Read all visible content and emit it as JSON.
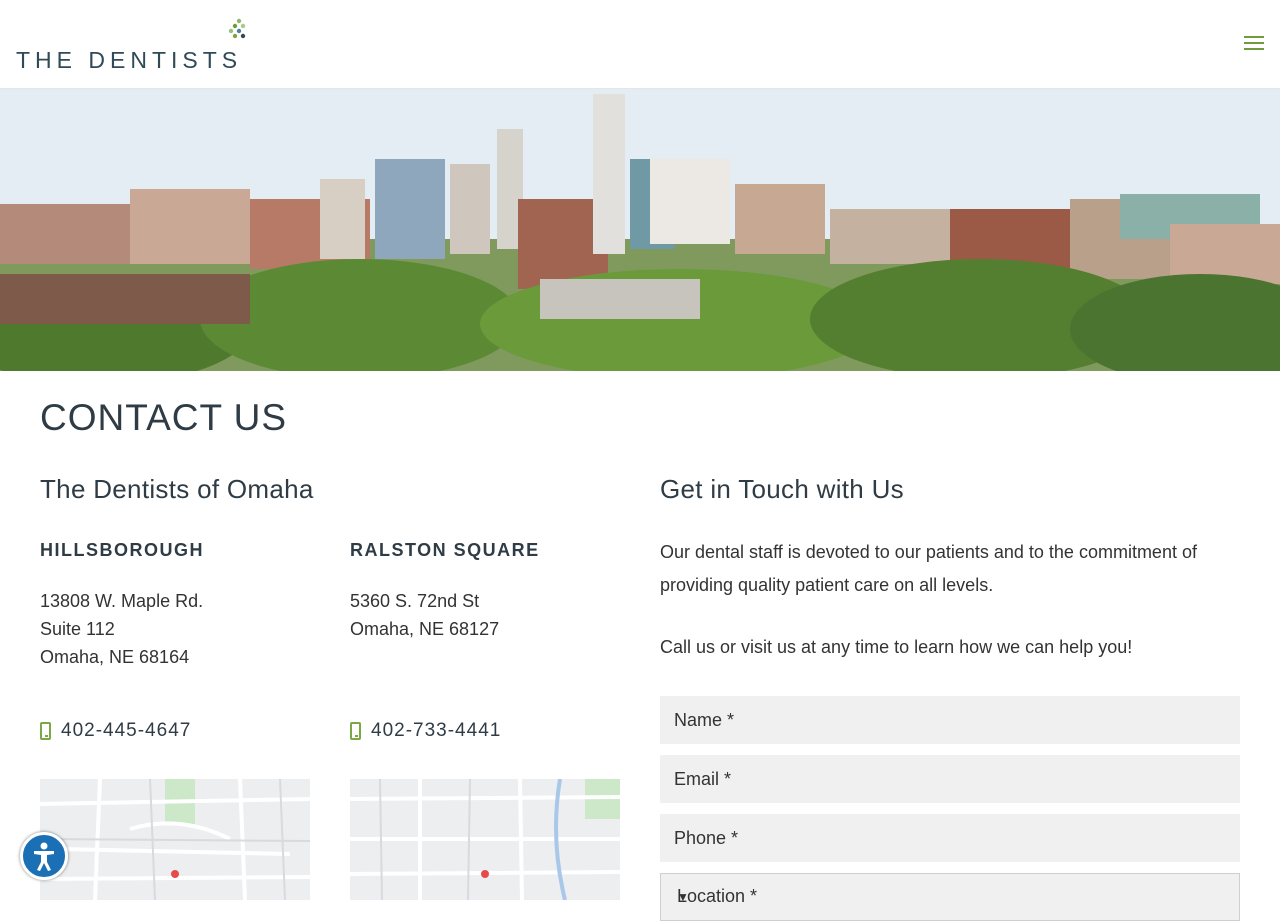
{
  "header": {
    "logo_text": "THE DENTISTS",
    "menu_icon": "hamburger-icon",
    "accent_color": "#7ba744"
  },
  "page": {
    "title": "CONTACT US"
  },
  "locations": {
    "heading": "The Dentists of Omaha",
    "items": [
      {
        "name": "HILLSBOROUGH",
        "address_lines": [
          "13808 W. Maple Rd.",
          "Suite 112",
          "Omaha, NE 68164"
        ],
        "phone": "402-445-4647",
        "phone_icon": "mobile-phone-icon"
      },
      {
        "name": "RALSTON SQUARE",
        "address_lines": [
          "5360 S. 72nd St",
          "Omaha, NE 68127"
        ],
        "phone": "402-733-4441",
        "phone_icon": "mobile-phone-icon"
      }
    ]
  },
  "contact": {
    "heading": "Get in Touch with Us",
    "intro": "Our dental staff is devoted to our patients and to the commitment of providing quality patient care on all levels.",
    "intro2": "Call us or visit us at any time to learn how we can help you!",
    "form": {
      "name_placeholder": "Name *",
      "email_placeholder": "Email *",
      "phone_placeholder": "Phone *",
      "location_placeholder": "Location *"
    }
  },
  "accessibility": {
    "icon": "accessibility-icon"
  }
}
